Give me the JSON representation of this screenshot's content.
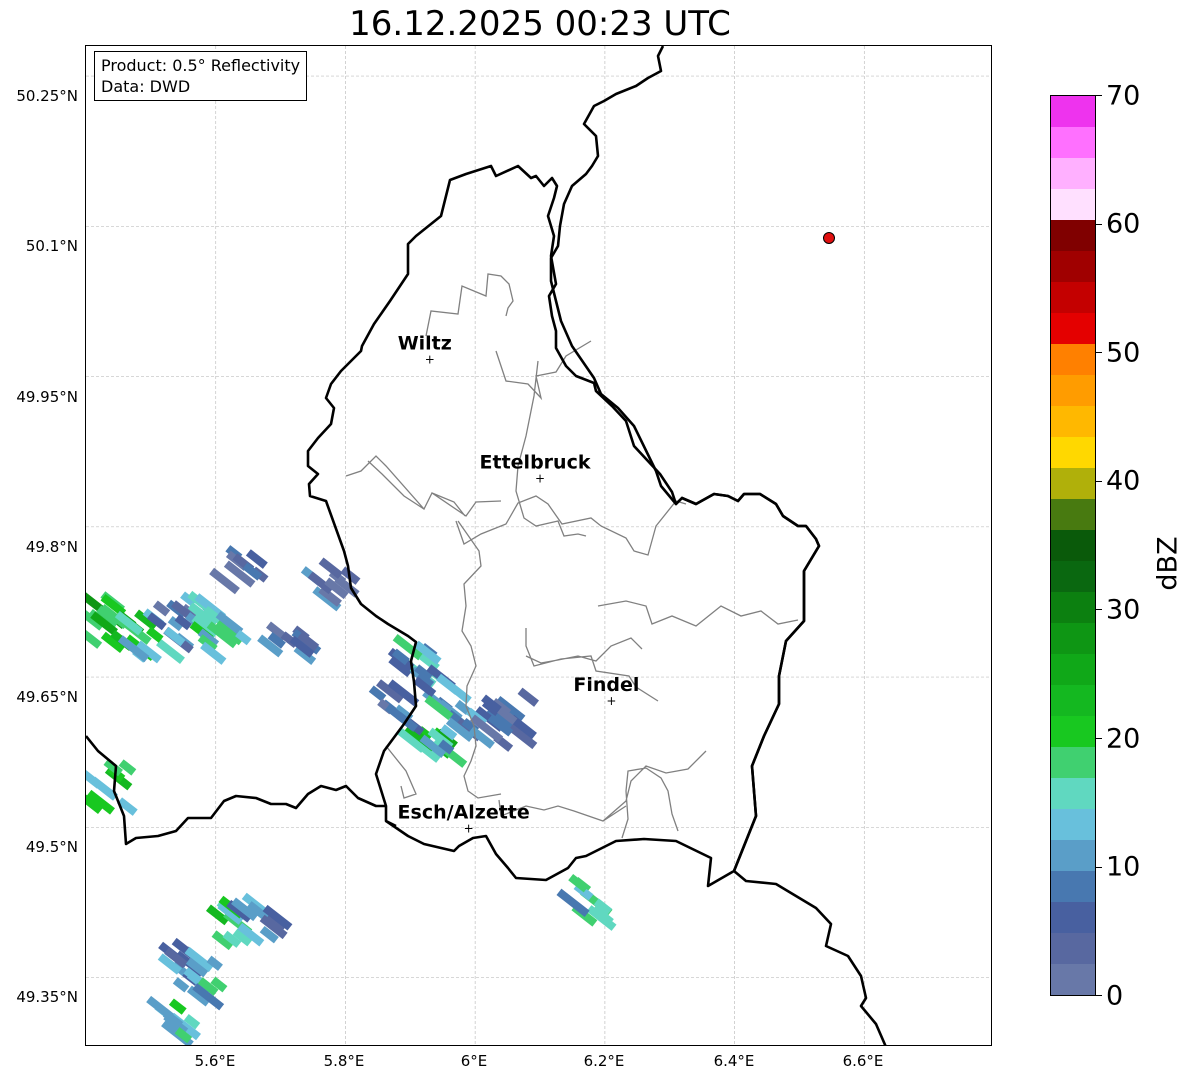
{
  "title": "16.12.2025 00:23 UTC",
  "info_box": {
    "product": "Product: 0.5° Reflectivity",
    "data": "Data: DWD"
  },
  "lat_labels": [
    "50.25°N",
    "50.1°N",
    "49.95°N",
    "49.8°N",
    "49.65°N",
    "49.5°N",
    "49.35°N"
  ],
  "lon_labels": [
    "5.6°E",
    "5.8°E",
    "6°E",
    "6.2°E",
    "6.4°E",
    "6.6°E"
  ],
  "cities": [
    {
      "name": "Wiltz",
      "lon": 5.93,
      "lat": 49.967
    },
    {
      "name": "Ettelbruck",
      "lon": 6.1,
      "lat": 49.848
    },
    {
      "name": "Findel",
      "lon": 6.21,
      "lat": 49.626
    },
    {
      "name": "Esch/Alzette",
      "lon": 5.99,
      "lat": 49.499
    }
  ],
  "radar_site_color": "#e01010",
  "colorbar": {
    "unit": "dBZ",
    "tick_labels": [
      "0",
      "10",
      "20",
      "30",
      "40",
      "50",
      "60",
      "70"
    ],
    "colors": [
      "#6878a8",
      "#5868a0",
      "#4860a0",
      "#4878b0",
      "#5a9ec8",
      "#68c0dc",
      "#60d8c0",
      "#40d070",
      "#18c820",
      "#14b820",
      "#10a818",
      "#0e9614",
      "#0c8010",
      "#0a6810",
      "#0a5a0a",
      "#487a10",
      "#b0b00a",
      "#ffd800",
      "#ffb800",
      "#ff9c00",
      "#ff8000",
      "#e40000",
      "#c40000",
      "#a00000",
      "#800000",
      "#ffe0ff",
      "#ffb0ff",
      "#ff70ff",
      "#ee33ee"
    ]
  },
  "echoes": [
    {
      "lon": 5.43,
      "lat": 49.708,
      "dbz": 22
    },
    {
      "lon": 5.46,
      "lat": 49.7,
      "dbz": 24
    },
    {
      "lon": 5.5,
      "lat": 49.69,
      "dbz": 15
    },
    {
      "lon": 5.54,
      "lat": 49.7,
      "dbz": 8
    },
    {
      "lon": 5.58,
      "lat": 49.72,
      "dbz": 12
    },
    {
      "lon": 5.61,
      "lat": 49.69,
      "dbz": 16
    },
    {
      "lon": 5.64,
      "lat": 49.755,
      "dbz": 7
    },
    {
      "lon": 5.71,
      "lat": 49.69,
      "dbz": 6
    },
    {
      "lon": 5.78,
      "lat": 49.745,
      "dbz": 6
    },
    {
      "lon": 5.92,
      "lat": 49.66,
      "dbz": 12
    },
    {
      "lon": 5.95,
      "lat": 49.64,
      "dbz": 10
    },
    {
      "lon": 5.93,
      "lat": 49.585,
      "dbz": 22
    },
    {
      "lon": 5.97,
      "lat": 49.6,
      "dbz": 14
    },
    {
      "lon": 6.01,
      "lat": 49.6,
      "dbz": 8
    },
    {
      "lon": 6.05,
      "lat": 49.61,
      "dbz": 6
    },
    {
      "lon": 5.88,
      "lat": 49.62,
      "dbz": 7
    },
    {
      "lon": 5.43,
      "lat": 49.54,
      "dbz": 18
    },
    {
      "lon": 5.63,
      "lat": 49.405,
      "dbz": 20
    },
    {
      "lon": 5.67,
      "lat": 49.41,
      "dbz": 8
    },
    {
      "lon": 5.53,
      "lat": 49.36,
      "dbz": 8
    },
    {
      "lon": 5.59,
      "lat": 49.35,
      "dbz": 14
    },
    {
      "lon": 5.54,
      "lat": 49.31,
      "dbz": 16
    },
    {
      "lon": 6.17,
      "lat": 49.425,
      "dbz": 14
    }
  ]
}
